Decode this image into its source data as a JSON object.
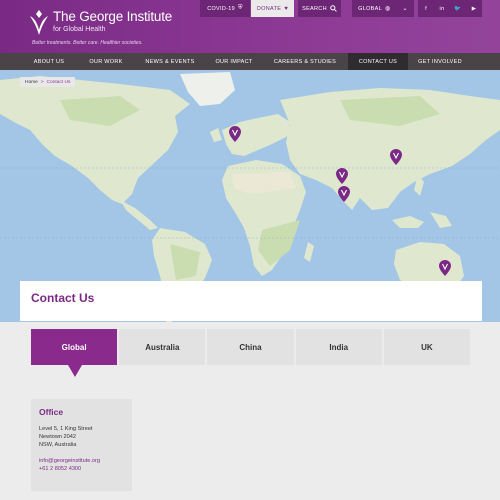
{
  "brand": {
    "name": "The George Institute",
    "sub": "for Global Health",
    "tagline": "Better treatments. Better care. Healthier societies."
  },
  "topbar": {
    "covid": "COVID-19",
    "donate": "DONATE",
    "search": "SEARCH",
    "global": "GLOBAL",
    "social": [
      "facebook-icon",
      "linkedin-icon",
      "twitter-icon",
      "youtube-icon"
    ]
  },
  "nav": [
    "ABOUT US",
    "OUR WORK",
    "NEWS & EVENTS",
    "OUR IMPACT",
    "CAREERS & STUDIES",
    "CONTACT US",
    "GET INVOLVED"
  ],
  "nav_active": "CONTACT US",
  "breadcrumb": {
    "home": "Home",
    "sep": ">",
    "current": "Contact Us"
  },
  "page": {
    "title": "Contact Us"
  },
  "tabs": [
    "Global",
    "Australia",
    "China",
    "India",
    "UK"
  ],
  "tab_active": "Global",
  "office": {
    "heading": "Office",
    "address": [
      "Level 5, 1 King Street",
      "Newtown 2042",
      "NSW, Australia"
    ],
    "email": "info@georgeinstitute.org",
    "phone": "+61 2 8052 4300"
  },
  "colors": {
    "brand": "#7a2a85",
    "nav": "#4a4449",
    "ocean": "#a3c6e6",
    "land": "#dfe8cf"
  }
}
